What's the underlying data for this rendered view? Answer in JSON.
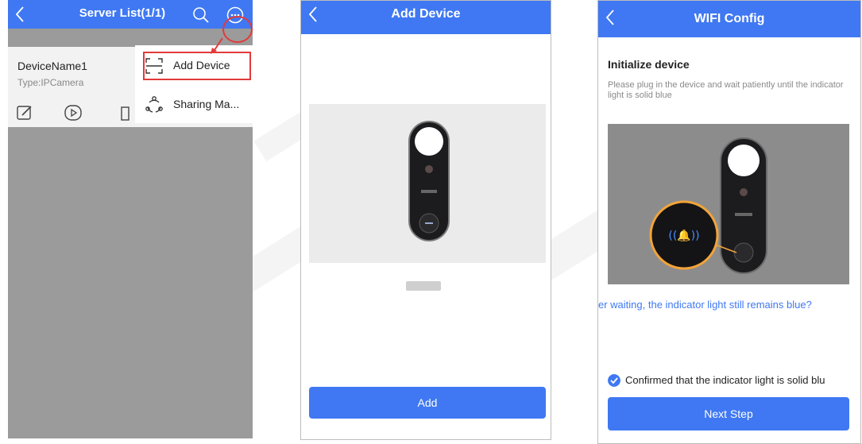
{
  "screen1": {
    "title": "Server List(1/1)",
    "device_name": "DeviceName1",
    "device_type": "Type:IPCamera",
    "menu": [
      {
        "label": "Add Device",
        "icon": "scan-icon"
      },
      {
        "label": "Sharing Ma...",
        "icon": "share-icon"
      }
    ]
  },
  "screen2": {
    "title": "Add Device",
    "add_label": "Add"
  },
  "screen3": {
    "title": "WIFI Config",
    "heading": "Initialize device",
    "hint": "Please plug in the device and wait patiently until the indicator light is solid blue",
    "link": "er waiting, the indicator light still remains blue?",
    "confirm": "Confirmed that the indicator light is solid blu",
    "next_label": "Next Step"
  },
  "colors": {
    "accent": "#3f78f2",
    "highlight": "#e23a3a",
    "overlay": "#9b9b9b"
  }
}
